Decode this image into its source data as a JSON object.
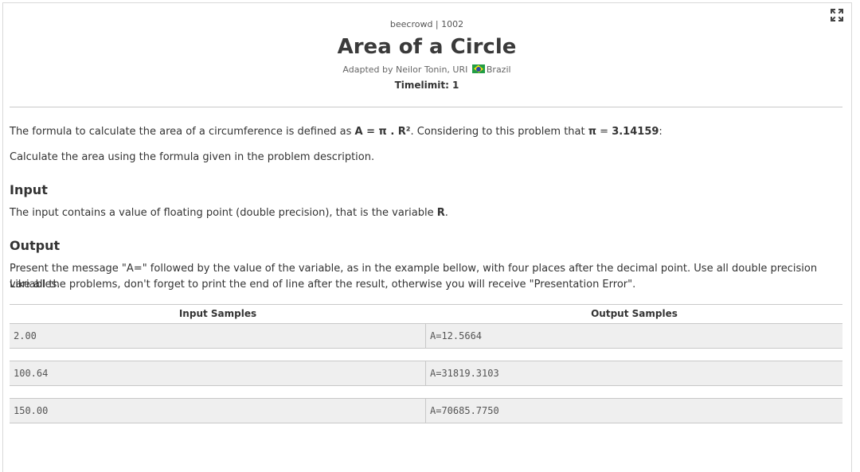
{
  "header": {
    "breadcrumb": "beecrowd | 1002",
    "title": "Area of a Circle",
    "adapted_by": "Adapted by Neilor Tonin, URI",
    "country": "Brazil",
    "timelimit": "Timelimit: 1"
  },
  "description": {
    "formula_pre": "The formula to calculate the area of a circumference is defined as ",
    "formula": "A = π . R²",
    "formula_mid": ". Considering to this problem that ",
    "pi_symbol": "π",
    "pi_eq": " = ",
    "pi_value": "3.14159",
    "formula_end": ":",
    "paragraph2": "Calculate the area using the formula given in the problem description."
  },
  "input_section": {
    "heading": "Input",
    "text_pre": "The input contains a value of floating point (double precision), that is the variable ",
    "variable": "R",
    "text_end": "."
  },
  "output_section": {
    "heading": "Output",
    "line1": "Present the message \"A=\" followed by the value of the variable, as in the example bellow, with four places after the decimal point. Use all double precision variables.",
    "line2": "Like all the problems, don't forget to print the end of line after the result, otherwise you will receive \"Presentation Error\"."
  },
  "samples": {
    "input_header": "Input Samples",
    "output_header": "Output Samples",
    "rows": [
      {
        "input": "2.00",
        "output": "A=12.5664"
      },
      {
        "input": "100.64",
        "output": "A=31819.3103"
      },
      {
        "input": "150.00",
        "output": "A=70685.7750"
      }
    ]
  },
  "icons": {
    "fullscreen": "fullscreen-icon",
    "flag": "brazil-flag-icon"
  },
  "colors": {
    "border": "#c8c8c8",
    "sample_bg": "#efefef",
    "text": "#333333"
  }
}
